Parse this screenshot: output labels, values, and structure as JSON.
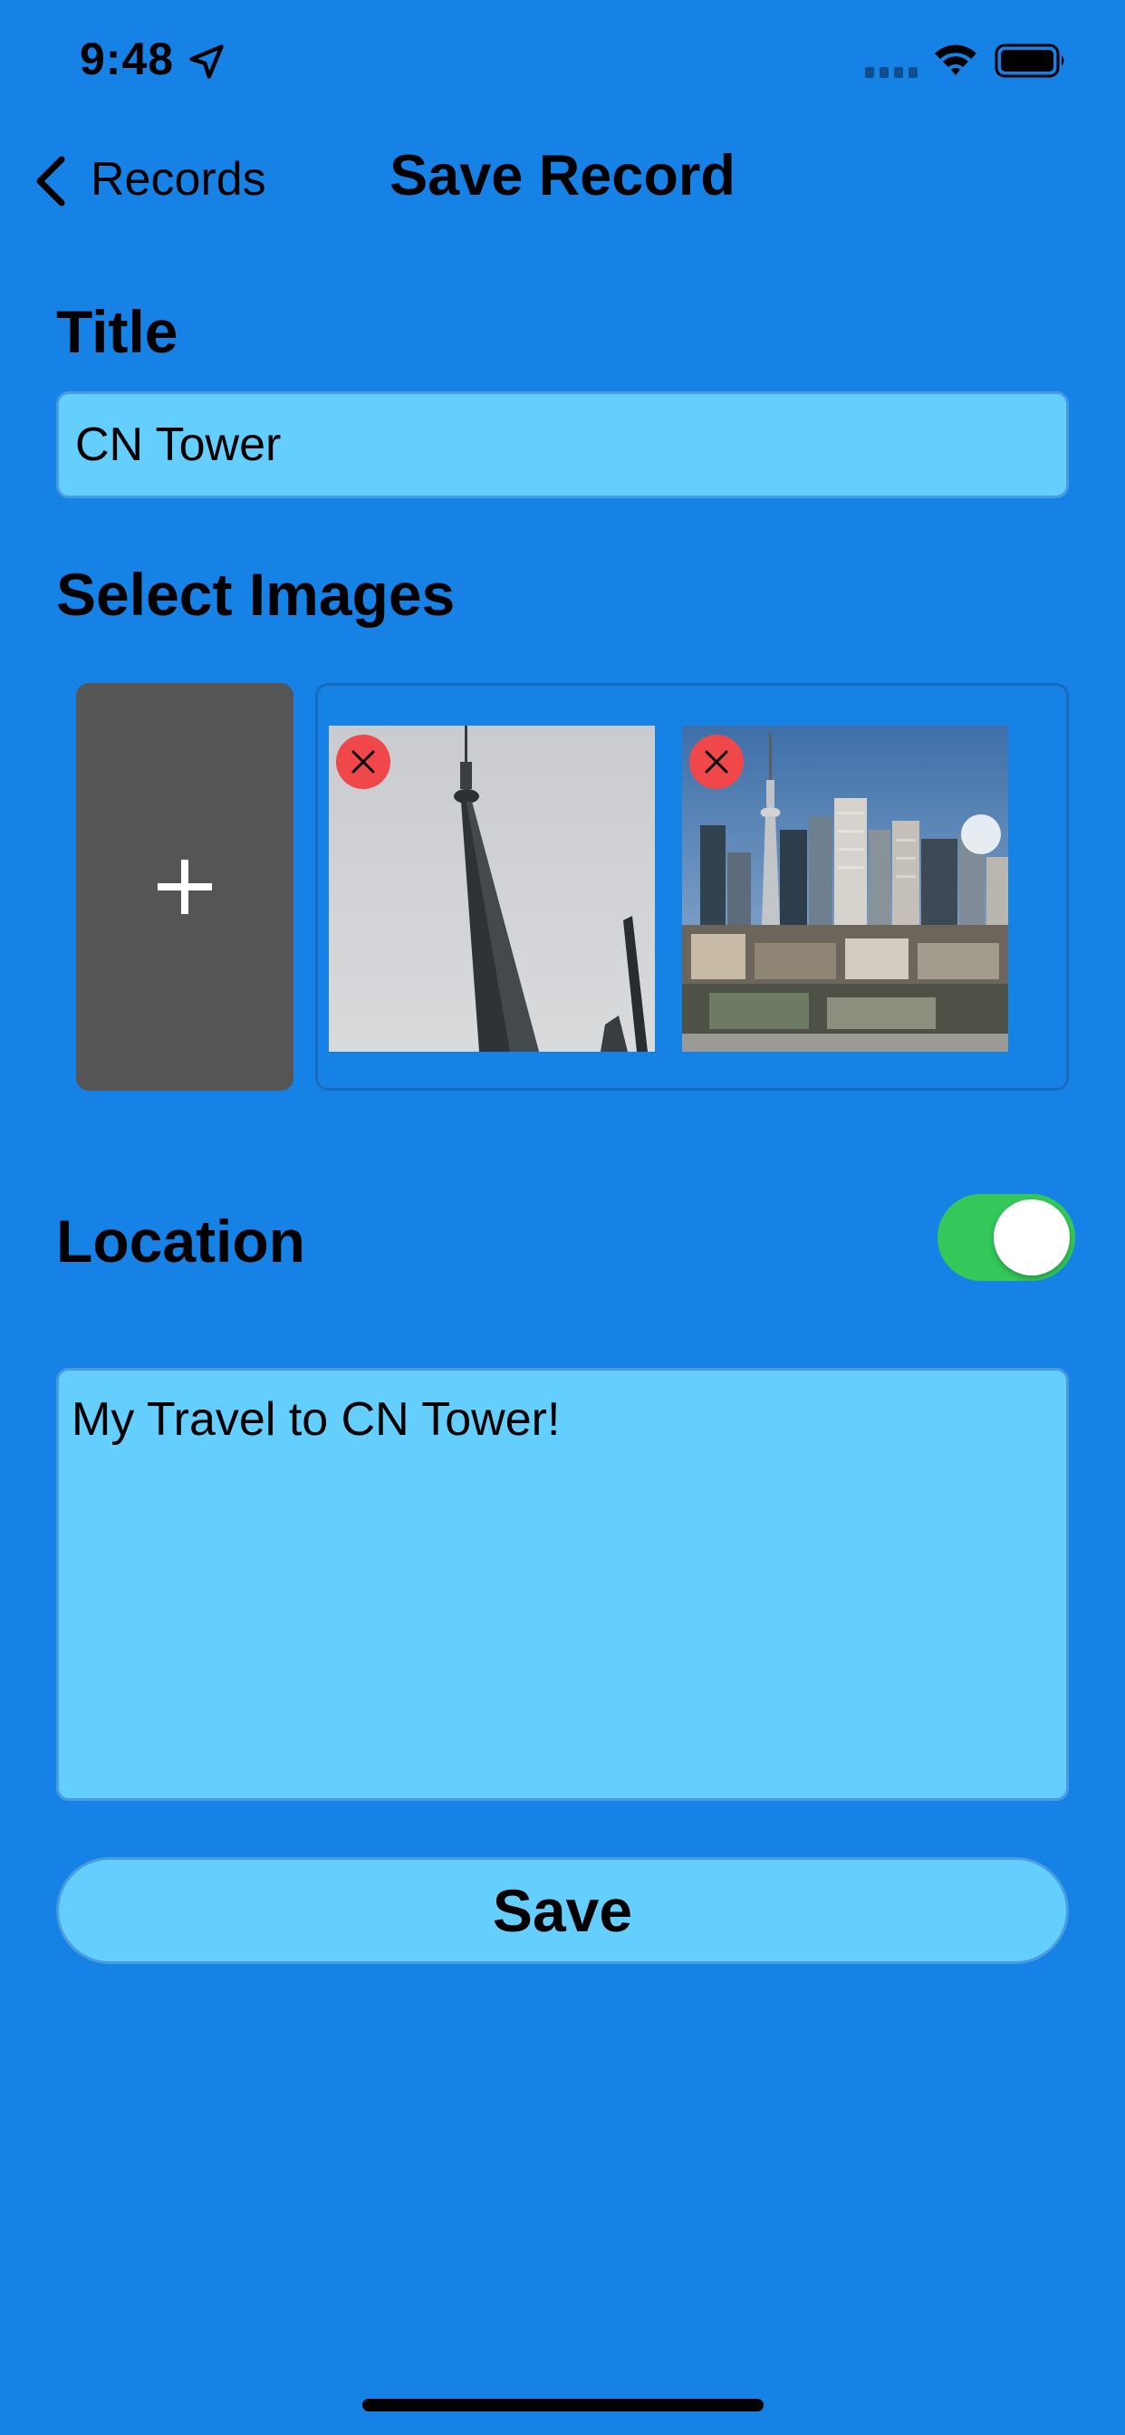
{
  "status_bar": {
    "time": "9:48"
  },
  "nav": {
    "back_label": "Records",
    "title": "Save Record"
  },
  "title_section": {
    "label": "Title",
    "value": "CN Tower"
  },
  "images_section": {
    "label": "Select Images",
    "add_glyph": "+",
    "images": [
      {
        "description": "cn-tower-closeup-photo"
      },
      {
        "description": "toronto-skyline-photo"
      }
    ]
  },
  "location_section": {
    "label": "Location",
    "toggle_on": true
  },
  "notes": {
    "value": "My Travel to CN Tower!"
  },
  "save_button": {
    "label": "Save"
  },
  "colors": {
    "background": "#1682E6",
    "field": "#64CEFD",
    "add_tile": "#555555",
    "toggle_on": "#34C759",
    "remove": "#F0474A"
  }
}
